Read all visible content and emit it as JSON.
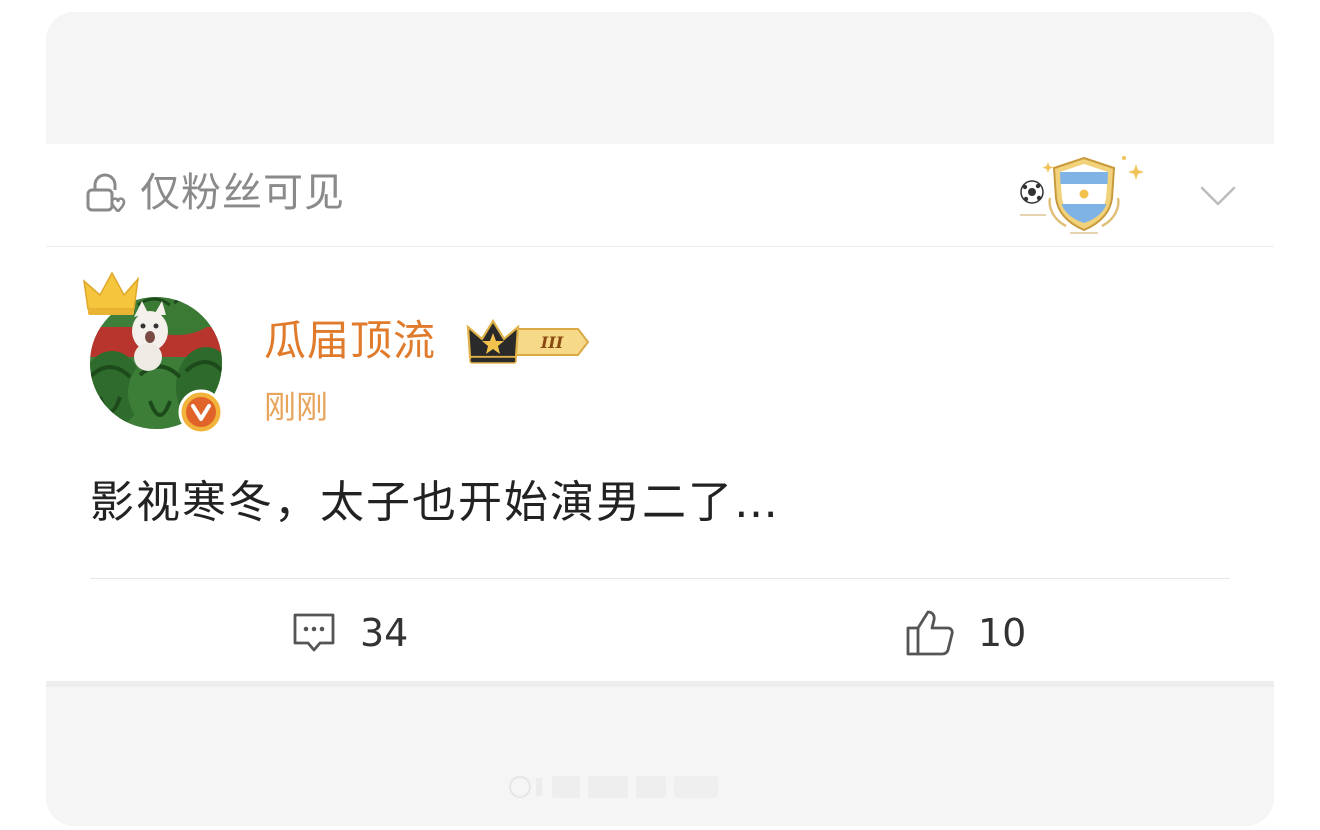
{
  "visibility": {
    "label": "仅粉丝可见",
    "icon": "lock-fan-icon",
    "menu_icon": "chevron-down-icon"
  },
  "post": {
    "author": {
      "name": "瓜届顶流",
      "avatar_icon": "avatar",
      "verified_icon": "verified-v-icon",
      "rank_label": "III"
    },
    "time": "刚刚",
    "text": "影视寒冬，太子也开始演男二了…",
    "actions": {
      "comment_count": "34",
      "like_count": "10"
    }
  },
  "colors": {
    "username": "#e07b2c",
    "time": "#e8a45b",
    "muted": "#8a8a8a",
    "background": "#f5f5f6"
  }
}
